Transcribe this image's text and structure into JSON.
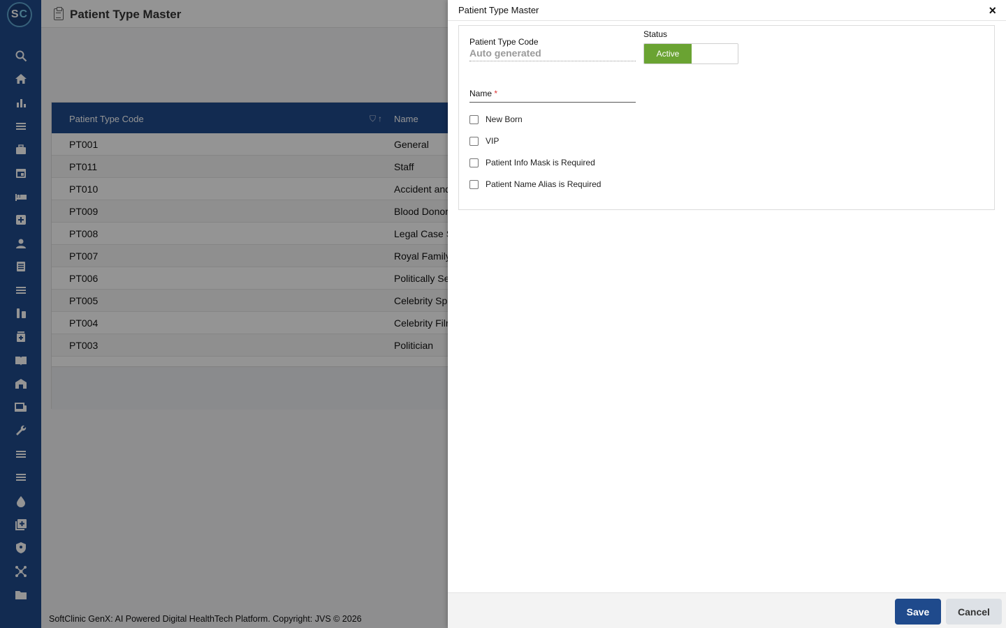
{
  "app": {
    "logo_text_s": "S",
    "logo_text_c": "C",
    "page_title": "Patient Type Master"
  },
  "sidebar": {
    "icons": [
      "search-icon",
      "home-icon",
      "bar-chart-icon",
      "menu-icon",
      "medical-bag-icon",
      "calendar-icon",
      "bed-icon",
      "medical-plus-icon",
      "person-icon",
      "receipt-icon",
      "list-icon",
      "lab-icon",
      "pharmacy-icon",
      "book-icon",
      "building-icon",
      "devices-icon",
      "wrench-icon",
      "menu-icon",
      "menu-icon",
      "drop-icon",
      "add-box-icon",
      "shield-icon",
      "network-icon",
      "folder-icon"
    ]
  },
  "table": {
    "headers": {
      "code": "Patient Type Code",
      "name": "Name"
    },
    "rows": [
      {
        "code": "PT001",
        "name": "General"
      },
      {
        "code": "PT011",
        "name": "Staff"
      },
      {
        "code": "PT010",
        "name": "Accident and"
      },
      {
        "code": "PT009",
        "name": "Blood Donor"
      },
      {
        "code": "PT008",
        "name": "Legal Case S"
      },
      {
        "code": "PT007",
        "name": "Royal Family"
      },
      {
        "code": "PT006",
        "name": "Politically Se"
      },
      {
        "code": "PT005",
        "name": "Celebrity Sp"
      },
      {
        "code": "PT004",
        "name": "Celebrity Filr"
      },
      {
        "code": "PT003",
        "name": "Politician"
      }
    ]
  },
  "footer": {
    "text": "SoftClinic GenX: AI Powered Digital HealthTech Platform. Copyright: JVS © 2026"
  },
  "drawer": {
    "title": "Patient Type Master",
    "close": "×",
    "code_label": "Patient Type Code",
    "code_value": "Auto generated",
    "status_label": "Status",
    "status_value": "Active",
    "name_label": "Name",
    "name_required": "*",
    "checkboxes": [
      {
        "label": "New Born",
        "checked": false
      },
      {
        "label": "VIP",
        "checked": false
      },
      {
        "label": "Patient Info Mask is Required",
        "checked": false
      },
      {
        "label": "Patient Name Alias is Required",
        "checked": false
      }
    ],
    "save_label": "Save",
    "cancel_label": "Cancel"
  }
}
